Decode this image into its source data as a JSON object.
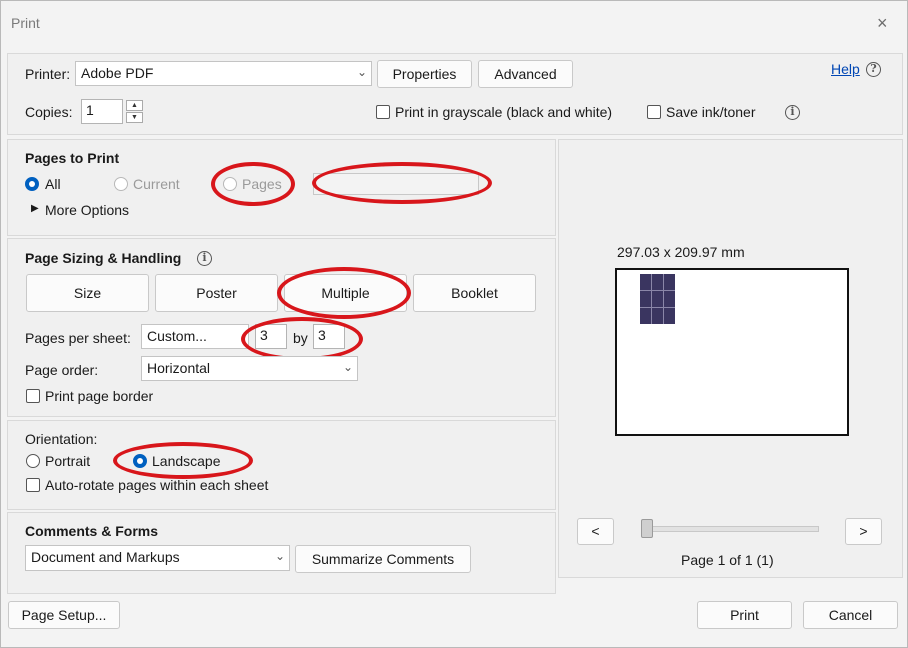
{
  "window": {
    "title": "Print",
    "close_icon": "×"
  },
  "printer": {
    "label": "Printer:",
    "value": "Adobe PDF",
    "properties": "Properties",
    "advanced": "Advanced",
    "help": "Help"
  },
  "copies": {
    "label": "Copies:",
    "value": "1",
    "grayscale": "Print in grayscale (black and white)",
    "save_ink": "Save ink/toner"
  },
  "pages_to_print": {
    "heading": "Pages to Print",
    "all": "All",
    "current": "Current",
    "pages": "Pages",
    "pages_value": "",
    "more_options": "More Options"
  },
  "sizing": {
    "heading": "Page Sizing & Handling",
    "tabs": [
      "Size",
      "Poster",
      "Multiple",
      "Booklet"
    ],
    "pps_label": "Pages per sheet:",
    "pps_value": "Custom...",
    "cols": "3",
    "by": "by",
    "rows": "3",
    "order_label": "Page order:",
    "order_value": "Horizontal",
    "border": "Print page border"
  },
  "orientation": {
    "heading": "Orientation:",
    "portrait": "Portrait",
    "landscape": "Landscape",
    "autorotate": "Auto-rotate pages within each sheet"
  },
  "comments": {
    "heading": "Comments & Forms",
    "value": "Document and Markups",
    "summarize": "Summarize Comments"
  },
  "preview": {
    "dimensions": "297.03 x 209.97 mm",
    "prev": "<",
    "next": ">",
    "page_info": "Page 1 of 1 (1)"
  },
  "footer": {
    "page_setup": "Page Setup...",
    "print": "Print",
    "cancel": "Cancel"
  },
  "colors": {
    "accent": "#0060c0",
    "annotation": "#d8161b",
    "thumb": "#3a3560"
  }
}
